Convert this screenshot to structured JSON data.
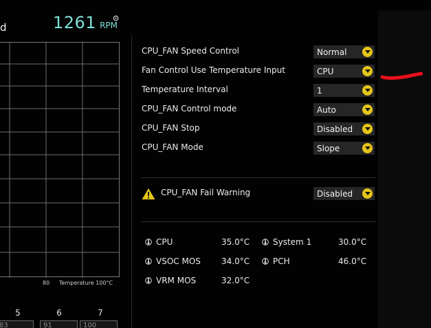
{
  "header": {
    "cut_text": "d",
    "fan_speed_value": "1261",
    "fan_speed_unit": "RPM"
  },
  "graph": {
    "x_tick_80": "80",
    "x_axis_label": "Temperature 100°C",
    "points": [
      {
        "num": "5",
        "value": "83"
      },
      {
        "num": "6",
        "value": "91"
      },
      {
        "num": "7",
        "value": "100"
      }
    ]
  },
  "settings": [
    {
      "label": "CPU_FAN Speed Control",
      "value": "Normal"
    },
    {
      "label": "Fan Control Use Temperature Input",
      "value": "CPU"
    },
    {
      "label": "Temperature Interval",
      "value": "1"
    },
    {
      "label": "CPU_FAN Control mode",
      "value": "Auto"
    },
    {
      "label": "CPU_FAN Stop",
      "value": "Disabled"
    },
    {
      "label": "CPU_FAN Mode",
      "value": "Slope"
    }
  ],
  "fail_warning": {
    "label": "CPU_FAN Fail Warning",
    "value": "Disabled"
  },
  "temperatures": [
    {
      "label": "CPU",
      "value": "35.0°C"
    },
    {
      "label": "System 1",
      "value": "30.0°C"
    },
    {
      "label": "VSOC MOS",
      "value": "34.0°C"
    },
    {
      "label": "PCH",
      "value": "46.0°C"
    },
    {
      "label": "VRM MOS",
      "value": "32.0°C"
    }
  ],
  "colors": {
    "accent_yellow": "#e6c619",
    "rpm_cyan": "#7fe0d8",
    "annotation_red": "#e8101a"
  },
  "icons": {
    "dropdown": "chevron-down-circle-icon",
    "warning": "warning-triangle-icon",
    "thermometer": "thermometer-icon",
    "gear": "gear-icon"
  }
}
